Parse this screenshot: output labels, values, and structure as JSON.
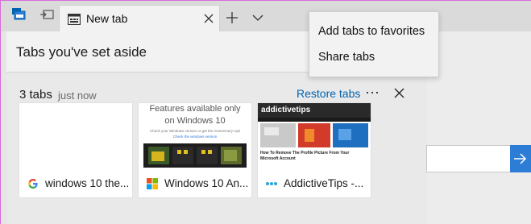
{
  "tab": {
    "title": "New tab"
  },
  "panel": {
    "title": "Tabs you've set aside"
  },
  "group": {
    "count_label": "3 tabs",
    "time_label": "just now",
    "restore_label": "Restore tabs",
    "more_label": "···"
  },
  "cards": [
    {
      "title": "windows 10 the...",
      "favicon": "google-icon"
    },
    {
      "title": "Windows 10 An...",
      "favicon": "windows-icon",
      "thumb_heading": "Features available only on Windows 10",
      "thumb_sub": "Check your Windows version or get the Anniversary Update",
      "thumb_link": "Check the windows version"
    },
    {
      "title": "AddictiveTips -...",
      "favicon": "addictivetips-icon",
      "thumb_logo": "addictivetips",
      "thumb_caption": "How To Remove The Profile Picture From Your Microsoft Account"
    }
  ],
  "menu": {
    "items": [
      {
        "label": "Add tabs to favorites"
      },
      {
        "label": "Share tabs"
      }
    ]
  },
  "colors": {
    "accent": "#0063b1",
    "go_button": "#2d7cd6",
    "frame": "#d86ad8"
  }
}
